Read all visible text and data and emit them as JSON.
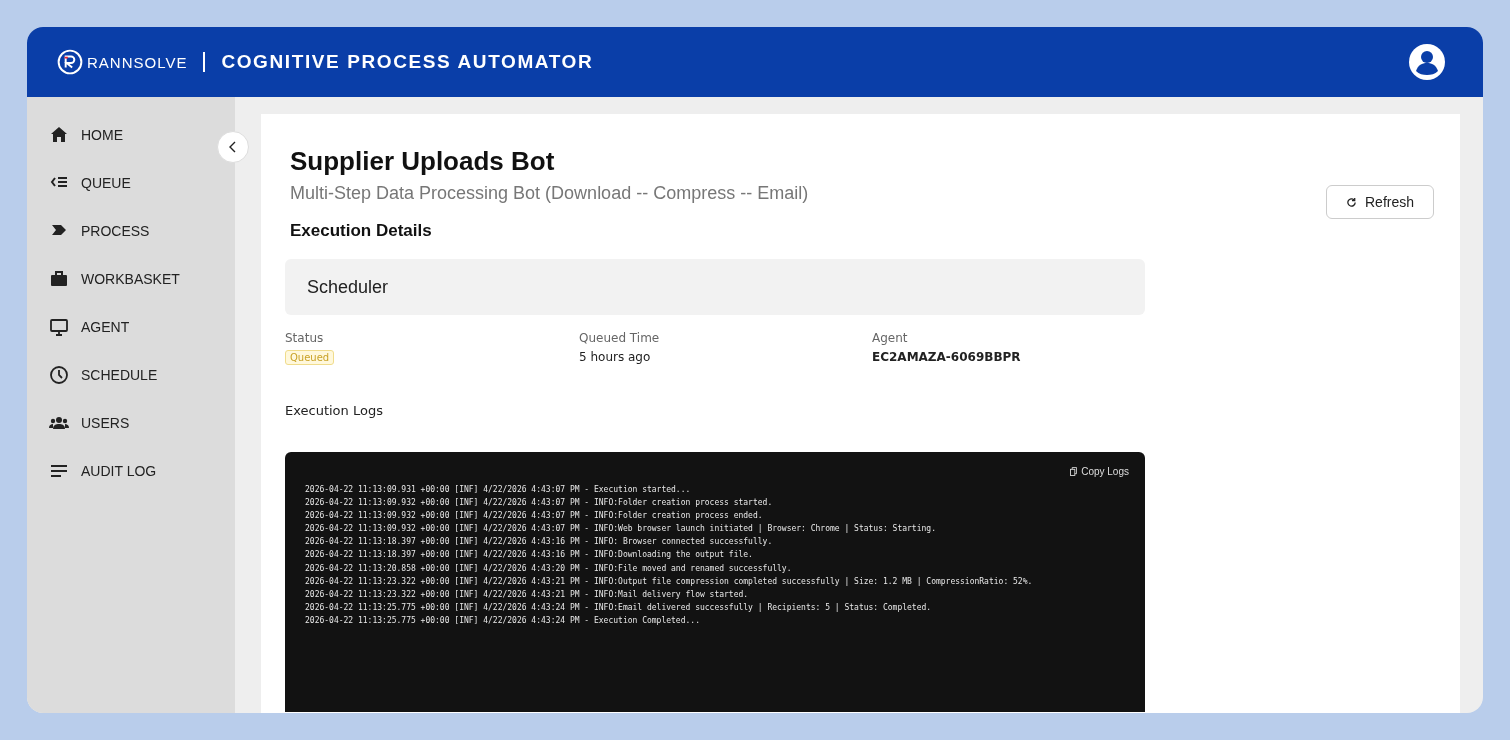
{
  "header": {
    "brand": "RANNSOLVE",
    "title": "COGNITIVE PROCESS AUTOMATOR"
  },
  "sidebar": {
    "items": [
      {
        "label": "HOME"
      },
      {
        "label": "QUEUE"
      },
      {
        "label": "PROCESS"
      },
      {
        "label": "WORKBASKET"
      },
      {
        "label": "AGENT"
      },
      {
        "label": "SCHEDULE"
      },
      {
        "label": "USERS"
      },
      {
        "label": "AUDIT LOG"
      }
    ]
  },
  "page": {
    "title": "Supplier Uploads Bot",
    "subtitle": "Multi-Step Data Processing Bot (Download -- Compress -- Email)",
    "refresh_button": "Refresh",
    "section_title": "Execution Details",
    "trigger": "Scheduler",
    "fields": [
      {
        "label": "Status",
        "value": "Queued",
        "kind": "badge"
      },
      {
        "label": "Queued Time",
        "value": "5 hours ago",
        "kind": "text"
      },
      {
        "label": "Agent",
        "value": "EC2AMAZA-6069BBPR",
        "kind": "bold"
      }
    ],
    "logs_title": "Execution Logs",
    "copy_button": "Copy Logs",
    "logs": [
      "2026-04-22 11:13:09.931 +00:00 [INF] 4/22/2026 4:43:07 PM - Execution started...",
      "2026-04-22 11:13:09.932 +00:00 [INF] 4/22/2026 4:43:07 PM - INFO:Folder creation process started.",
      "2026-04-22 11:13:09.932 +00:00 [INF] 4/22/2026 4:43:07 PM - INFO:Folder creation process ended.",
      "2026-04-22 11:13:09.932 +00:00 [INF] 4/22/2026 4:43:07 PM - INFO:Web browser launch initiated | Browser: Chrome | Status: Starting.",
      "2026-04-22 11:13:18.397 +00:00 [INF] 4/22/2026 4:43:16 PM - INFO: Browser connected successfully.",
      "2026-04-22 11:13:18.397 +00:00 [INF] 4/22/2026 4:43:16 PM - INFO:Downloading the output file.",
      "2026-04-22 11:13:20.858 +00:00 [INF] 4/22/2026 4:43:20 PM - INFO:File moved and renamed successfully.",
      "2026-04-22 11:13:23.322 +00:00 [INF] 4/22/2026 4:43:21 PM - INFO:Output file compression completed successfully | Size: 1.2 MB | CompressionRatio: 52%.",
      "2026-04-22 11:13:23.322 +00:00 [INF] 4/22/2026 4:43:21 PM - INFO:Mail delivery flow started.",
      "2026-04-22 11:13:25.775 +00:00 [INF] 4/22/2026 4:43:24 PM - INFO:Email delivered successfully | Recipients: 5 | Status: Completed.",
      "2026-04-22 11:13:25.775 +00:00 [INF] 4/22/2026 4:43:24 PM - Execution Completed..."
    ]
  }
}
